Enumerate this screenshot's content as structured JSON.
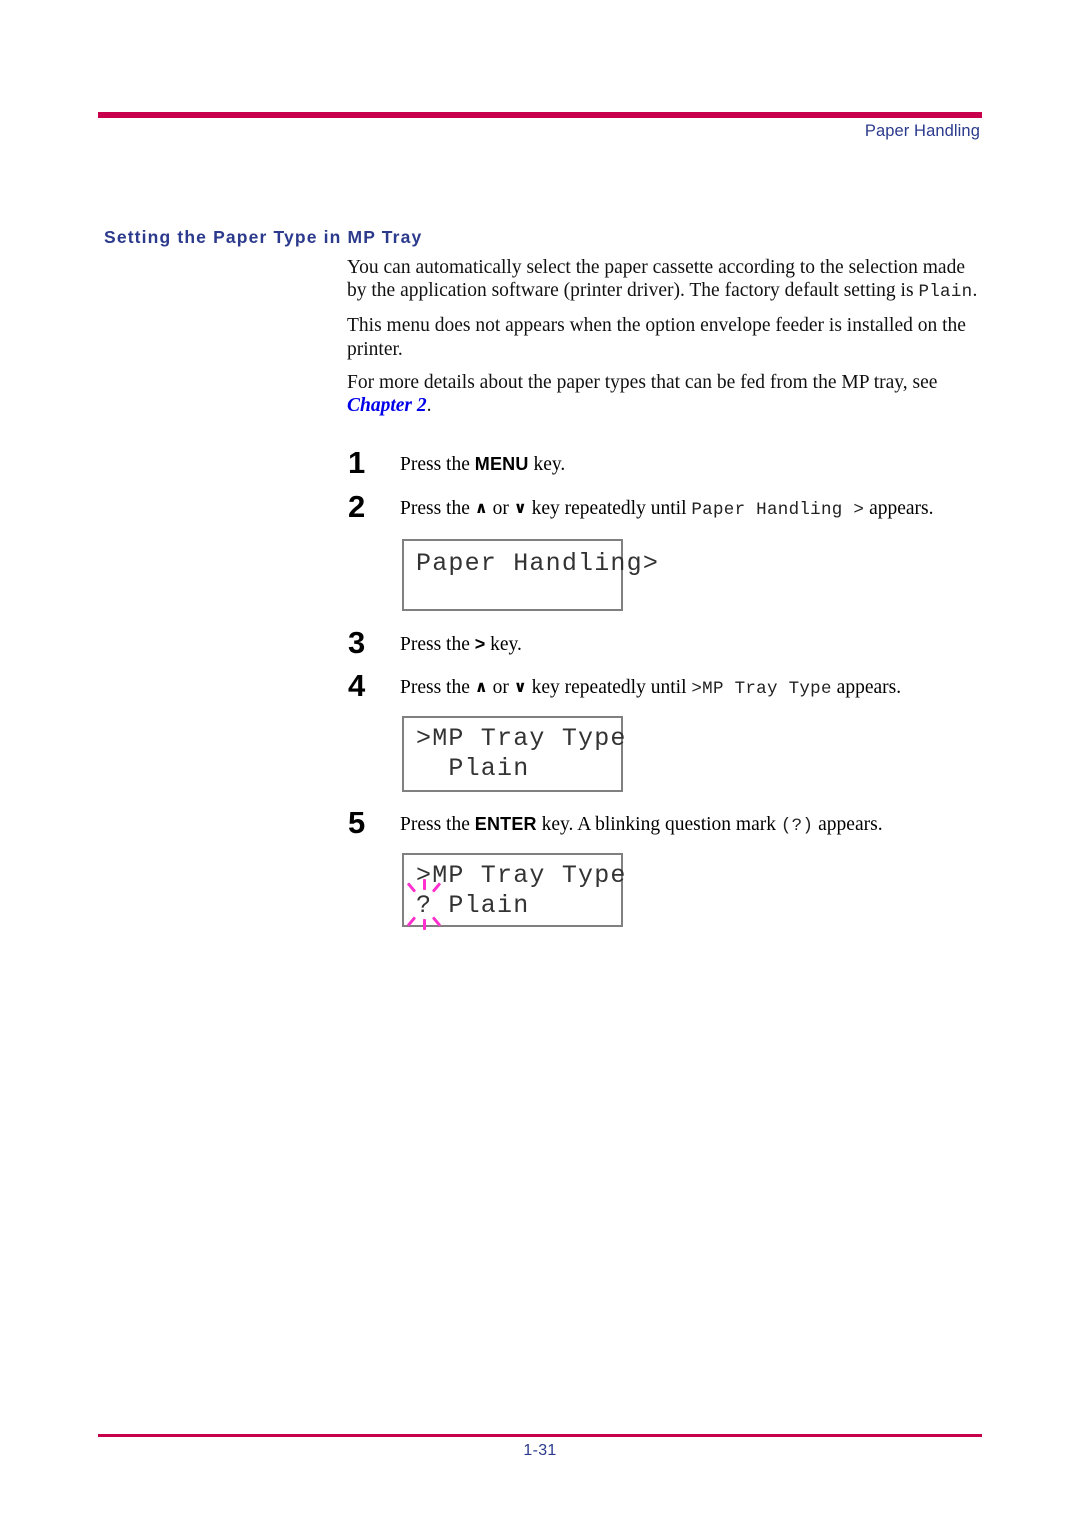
{
  "header": {
    "running_head": "Paper Handling",
    "rule_color": "#C8004B",
    "text_color": "#2B3A8C"
  },
  "section": {
    "heading": "Setting the Paper Type in MP Tray"
  },
  "paragraphs": [
    {
      "id": "p1",
      "parts": [
        {
          "type": "text",
          "value": "You can automatically select the paper cassette according to the selection made by the application software (printer driver). The factory default setting is "
        },
        {
          "type": "code",
          "value": "Plain"
        },
        {
          "type": "text",
          "value": "."
        }
      ],
      "lead": "You can automatically select the paper cassette according to the selection made by the application software (printer driver). The factory default setting is ",
      "code": "Plain",
      "tail": "."
    },
    {
      "id": "p2",
      "lead": "This menu does not appears when the option envelope feeder is installed on the printer.",
      "code": "",
      "tail": ""
    },
    {
      "id": "p3",
      "lead": "For more details about the paper types that can be fed from the MP tray, see ",
      "link": "Chapter 2",
      "tail": "."
    }
  ],
  "steps": [
    {
      "number": "1",
      "before": "Press the ",
      "key": "MENU",
      "after": " key."
    },
    {
      "number": "2",
      "before": "Press the ",
      "up": "∧",
      "or": " or ",
      "down": "∨",
      "mid": " key repeatedly until ",
      "code": "Paper Handling >",
      "after": " appears."
    },
    {
      "number": "3",
      "before": "Press the ",
      "key": ">",
      "after": " key."
    },
    {
      "number": "4",
      "before": "Press the ",
      "up": "∧",
      "or": " or ",
      "down": "∨",
      "mid": " key repeatedly until ",
      "code": ">MP Tray Type",
      "after": " appears."
    },
    {
      "number": "5",
      "before": "Press the ",
      "key": "ENTER",
      "mid": " key. A blinking question mark ",
      "code": "(?)",
      "after": " appears."
    }
  ],
  "lcd_panels": [
    {
      "id": "lcd-1",
      "line1": "Paper Handling>",
      "line2": ""
    },
    {
      "id": "lcd-2",
      "line1": ">MP Tray Type",
      "line2": "  Plain"
    },
    {
      "id": "lcd-3",
      "line1": ">MP Tray Type",
      "cursor": "?",
      "line2_rest": " Plain",
      "blink_color": "#FF2FD0"
    }
  ],
  "footer": {
    "page_number": "1-31",
    "rule_color": "#C8004B"
  }
}
